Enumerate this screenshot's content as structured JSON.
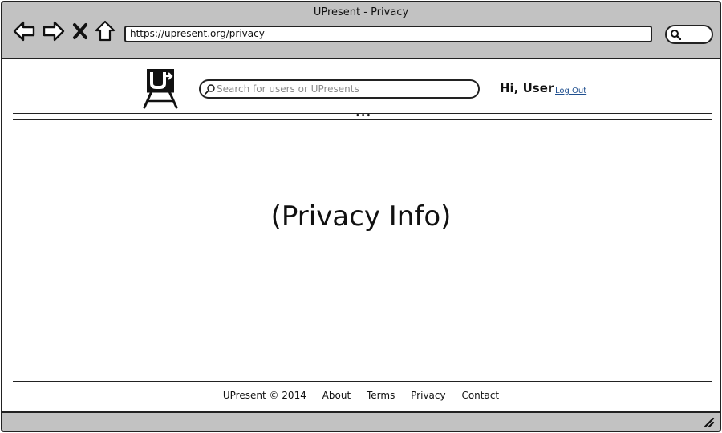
{
  "browser": {
    "window_title": "UPresent - Privacy",
    "url": "https://upresent.org/privacy",
    "nav_icons": [
      "back-arrow-icon",
      "forward-arrow-icon",
      "close-x-icon",
      "home-icon"
    ],
    "search_icon": "magnifier-icon"
  },
  "header": {
    "logo_icon": "upresent-easel-logo",
    "search": {
      "placeholder": "Search for users or UPresents",
      "value": ""
    },
    "greeting": "Hi, User",
    "logout_label": "Log Out"
  },
  "main": {
    "text": "(Privacy Info)"
  },
  "footer": {
    "copyright": "UPresent © 2014",
    "links": [
      "About",
      "Terms",
      "Privacy",
      "Contact"
    ]
  },
  "colors": {
    "chrome": "#c2c2c2",
    "link": "#1f4f8f",
    "placeholder": "#8a8a8a"
  }
}
